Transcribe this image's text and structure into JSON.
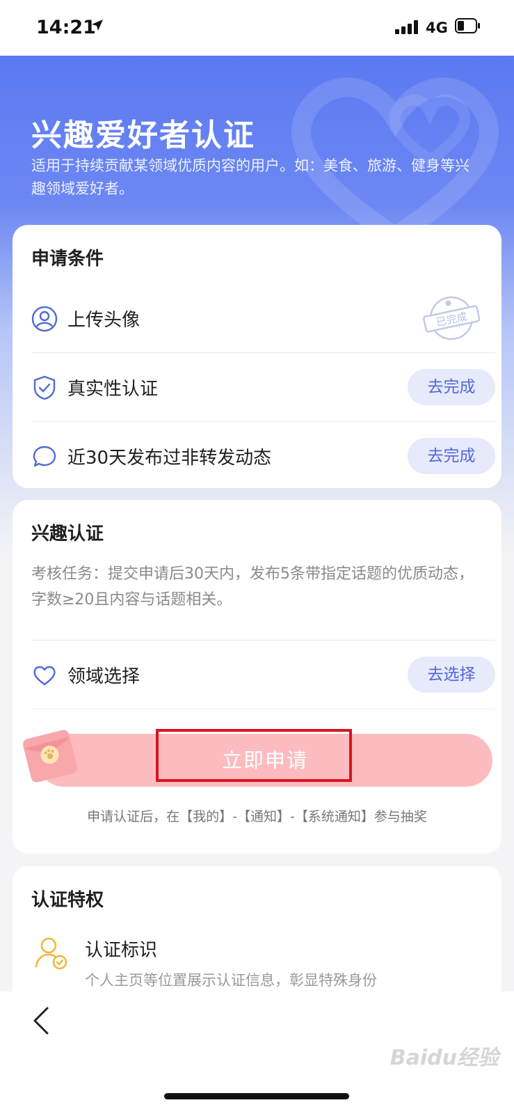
{
  "status_bar": {
    "time": "14:21",
    "network": "4G"
  },
  "hero": {
    "title": "兴趣爱好者认证",
    "subtitle": "适用于持续贡献某领域优质内容的用户。如：美食、旅游、健身等兴趣领域爱好者。"
  },
  "conditions": {
    "title": "申请条件",
    "items": [
      {
        "label": "上传头像",
        "icon": "avatar-icon",
        "status": "已完成"
      },
      {
        "label": "真实性认证",
        "icon": "shield-check-icon",
        "button": "去完成"
      },
      {
        "label": "近30天发布过非转发动态",
        "icon": "chat-bubble-icon",
        "button": "去完成"
      }
    ]
  },
  "interest": {
    "title": "兴趣认证",
    "task": "考核任务：提交申请后30天内，发布5条带指定话题的优质动态，字数≥20且内容与话题相关。",
    "domain_label": "领域选择",
    "domain_button": "去选择",
    "apply_label": "立即申请",
    "apply_note": "申请认证后，在【我的】-【通知】-【系统通知】参与抽奖"
  },
  "privileges": {
    "title": "认证特权",
    "items": [
      {
        "label": "认证标识",
        "desc": "个人主页等位置展示认证信息，彰显特殊身份",
        "icon": "user-badge-icon"
      }
    ]
  },
  "watermark": "Baidu经验",
  "colors": {
    "accent": "#5069d8",
    "hero": "#5b79f2",
    "apply": "#fcbcbf",
    "highlight": "#d9141e"
  }
}
